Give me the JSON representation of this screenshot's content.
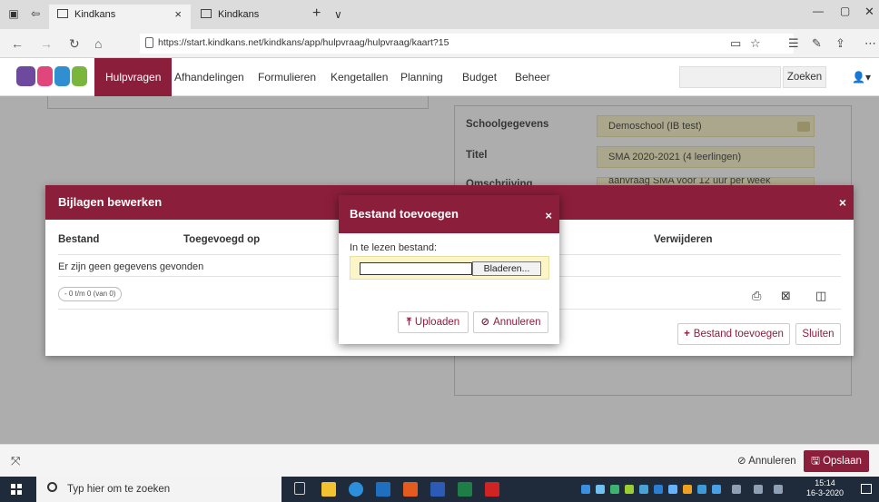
{
  "browser": {
    "tabs": [
      {
        "title": "Kindkans",
        "active": true
      },
      {
        "title": "Kindkans",
        "active": false
      }
    ],
    "new_tab": "+",
    "tab_list": "∨",
    "url": "https://start.kindkans.net/kindkans/app/hulpvraag/hulpvraag/kaart?15"
  },
  "nav": {
    "items": [
      "Hulpvragen",
      "Afhandelingen",
      "Formulieren",
      "Kengetallen",
      "Planning",
      "Budget",
      "Beheer"
    ],
    "active": "Hulpvragen",
    "search_button": "Zoeken"
  },
  "form": {
    "fields": [
      {
        "label": "Schoolgegevens",
        "value": "Demoschool (IB test)"
      },
      {
        "label": "Titel",
        "value": "SMA 2020-2021 (4 leerlingen)"
      },
      {
        "label": "Omschrijving",
        "value": "aanvraag SMA voor 12 uur per week"
      }
    ]
  },
  "bijlagen_modal": {
    "title": "Bijlagen bewerken",
    "close": "×",
    "columns": [
      "Bestand",
      "Toegevoegd op",
      "Verwijderen"
    ],
    "empty_message": "Er zijn geen gegevens gevonden",
    "pager": "- 0 t/m 0 (van 0)",
    "add_button": "Bestand toevoegen",
    "close_button": "Sluiten"
  },
  "upload_modal": {
    "title": "Bestand toevoegen",
    "close": "×",
    "file_label": "In te lezen bestand:",
    "browse_button": "Bladeren...",
    "upload_button": "Uploaden",
    "cancel_button": "Annuleren"
  },
  "footer": {
    "cancel": "Annuleren",
    "save": "Opslaan"
  },
  "taskbar": {
    "search_placeholder": "Typ hier om te zoeken",
    "time": "15:14",
    "date": "16-3-2020"
  },
  "colors": {
    "brand": "#8b1e3a",
    "field_bg": "#fbf5c8"
  }
}
